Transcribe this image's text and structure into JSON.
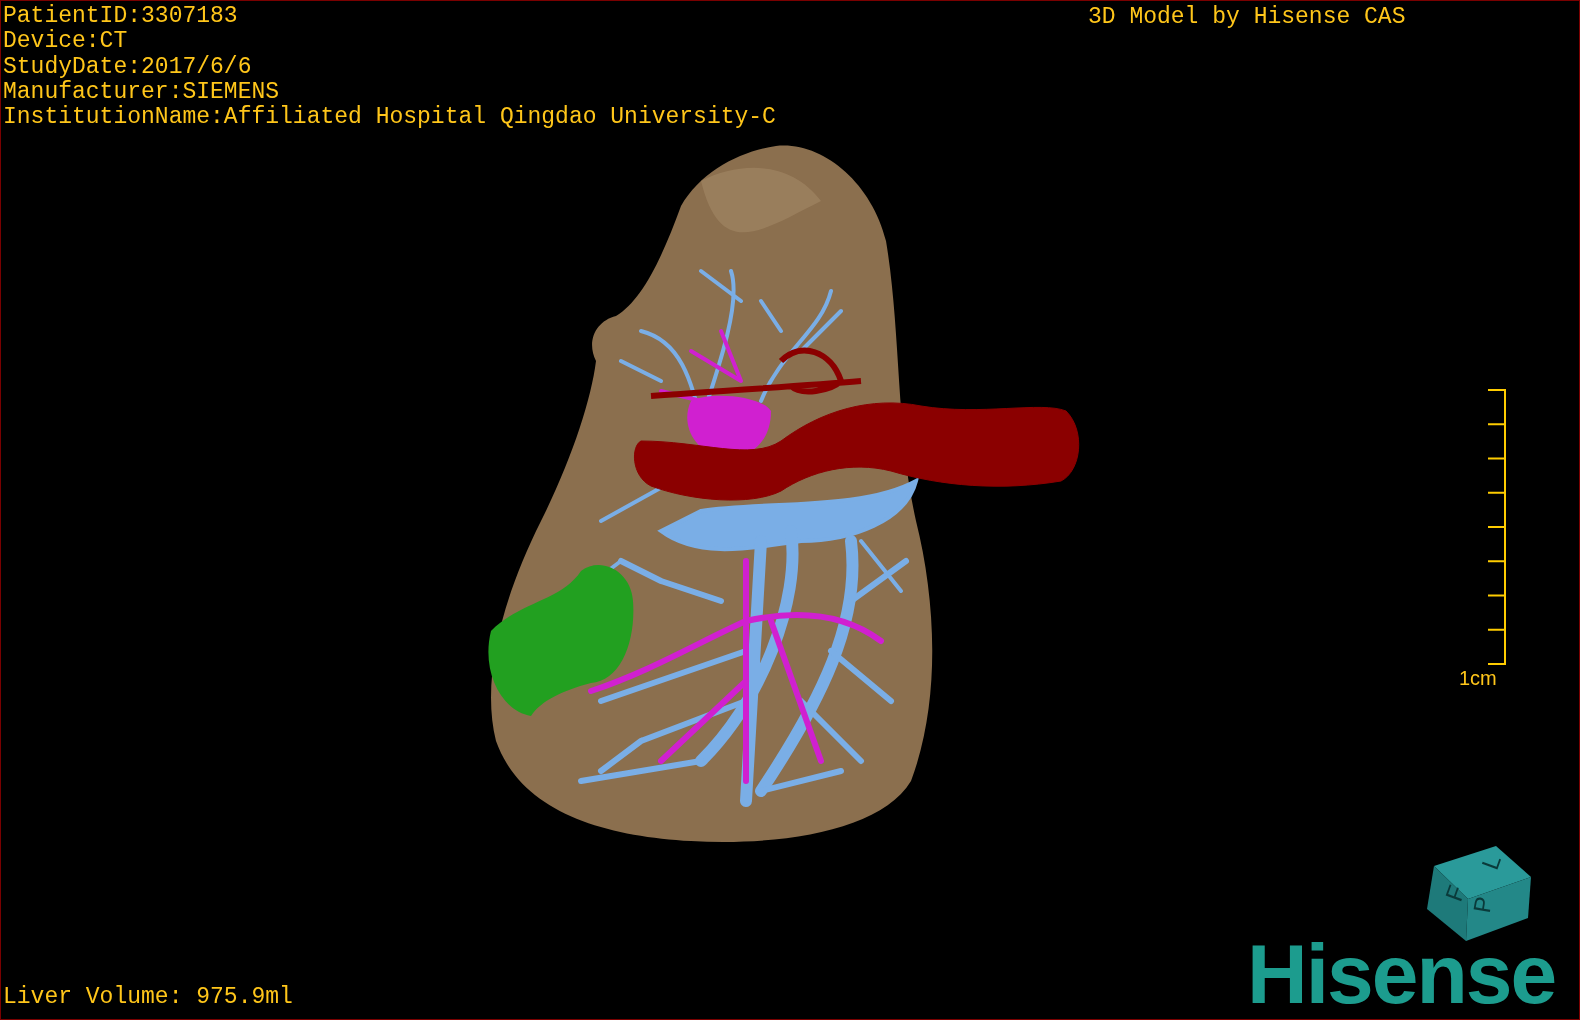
{
  "study_info": [
    "PatientID:3307183",
    "Device:CT",
    "StudyDate:2017/6/6",
    "Manufacturer:SIEMENS",
    "InstitutionName:Affiliated Hospital Qingdao University-C"
  ],
  "title": "3D Model by Hisense CAS",
  "scale_bar": {
    "label": "1cm"
  },
  "orientation_cube": {
    "faces": [
      "F",
      "L",
      "P"
    ]
  },
  "logo": "Hisense",
  "liver_volume": "Liver Volume: 975.9ml"
}
